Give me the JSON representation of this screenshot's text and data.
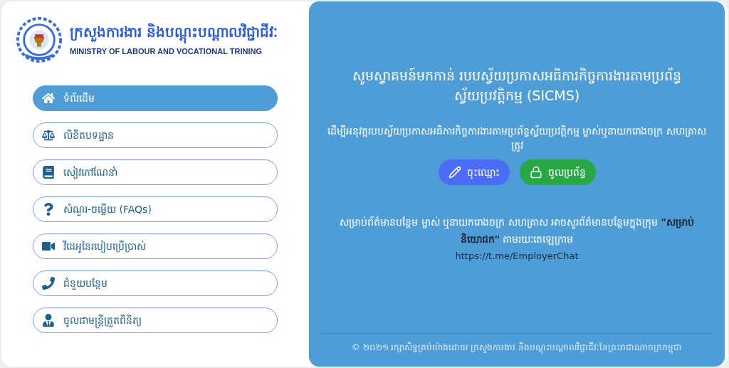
{
  "header": {
    "title_khmer": "ក្រសួងការងារ និងបណ្តុះបណ្តាលវិជ្ជាជីវៈ",
    "title_english": "MINISTRY OF LABOUR AND VOCATIONAL TRINING"
  },
  "menu": [
    {
      "label": "ទំព័រដើម",
      "selected": true
    },
    {
      "label": "លិខិតបទដ្ឋាន",
      "selected": false
    },
    {
      "label": "សៀវភៅណែនាំ",
      "selected": false
    },
    {
      "label": "សំណួរ-ចម្លើយ (FAQs)",
      "selected": false
    },
    {
      "label": "វីដេអូនៃរបៀបប្រើប្រាស់",
      "selected": false
    },
    {
      "label": "ជំនួយបន្ថែម",
      "selected": false
    },
    {
      "label": "ចូលជាមន្ត្រីត្រួតពិនិត្យ",
      "selected": false
    }
  ],
  "welcome": {
    "title": "សូមស្វាគមន៍មកកាន់ របបស្វ័យប្រកាសអធិការកិច្ចការងារតាមប្រព័ន្ធស្វ័យប្រវត្តិកម្ម (SICMS)",
    "subtitle": "ដើម្បីអនុវត្តរបបស្វ័យប្រកាសអធិការកិច្ចការងារតាមប្រព័ន្ធស្វ័យប្រវត្តិកម្ម ម្ចាស់ឬនាយករោងចក្រ សហគ្រាស ត្រូវ",
    "buttons": [
      {
        "label": "ចុះឈ្មោះ",
        "kind": "register"
      },
      {
        "label": "ចូលប្រព័ន្ធ",
        "kind": "login"
      }
    ],
    "info": "សម្រាប់ព័ត៌មានបន្ថែម ម្ចាស់ ឬនាយករោងចក្រ សហគ្រាស អាចសួរព័ត៌មានបន្ថែមក្នុងក្រុម **\"សម្រាប់និយោជក\"** តាមរយៈតេឡេក្រាម",
    "link": "https://t.me/EmployerChat"
  },
  "footer": "© ២០២១ រក្សាសិទ្ធគ្រប់យ៉ាងដោយ ក្រសួងការងារ និងបណ្តុះបណ្តាលវិជ្ជាជីវៈនៃព្រះរាជាណាចក្រកម្ពុជា"
}
